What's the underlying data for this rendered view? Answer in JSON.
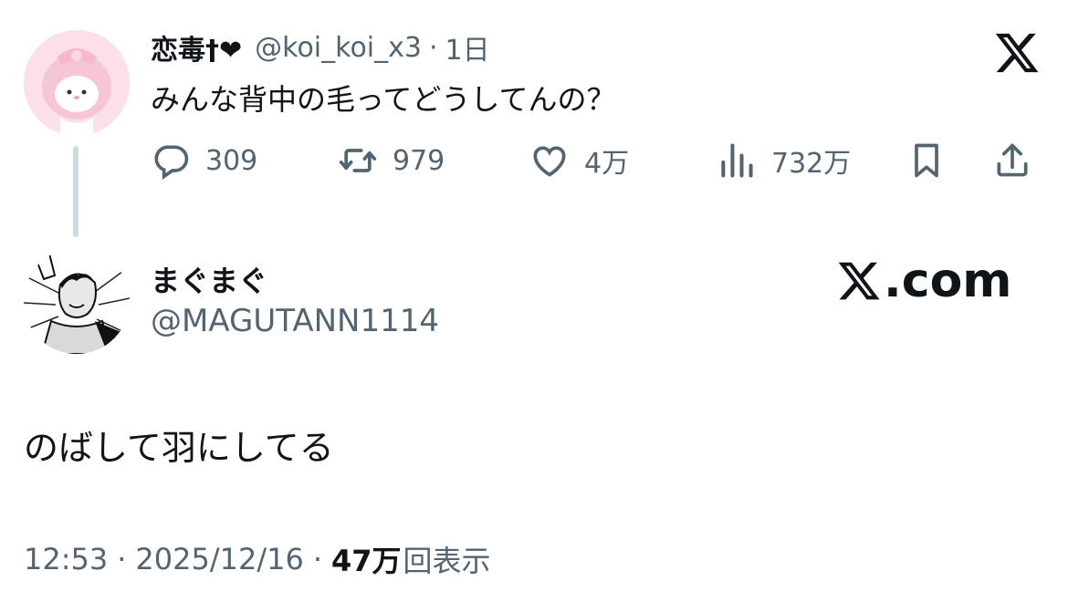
{
  "parent_tweet": {
    "display_name": "恋毒†❤",
    "handle": "@koi_koi_x3",
    "separator": "·",
    "time": "1日",
    "text": "みんな背中の毛ってどうしてんの？",
    "avatar_icon": "my-melody-avatar-icon",
    "actions": {
      "replies": "309",
      "reposts": "979",
      "likes": "4万",
      "views": "732万"
    }
  },
  "reply_tweet": {
    "display_name": "まぐまぐ",
    "handle": "@MAGUTANN1114",
    "avatar_icon": "manga-character-avatar-icon",
    "text": "のばして羽にしてる",
    "footer": {
      "time": "12:53",
      "separator": "·",
      "date": "2025/12/16",
      "views_count": "47万",
      "views_label": "回表示"
    }
  },
  "branding": {
    "x_logo": "x-logo-icon",
    "site_text": ".com"
  },
  "colors": {
    "text": "#0f1419",
    "muted": "#536471",
    "thread_line": "#cfd9de",
    "background": "#ffffff"
  }
}
